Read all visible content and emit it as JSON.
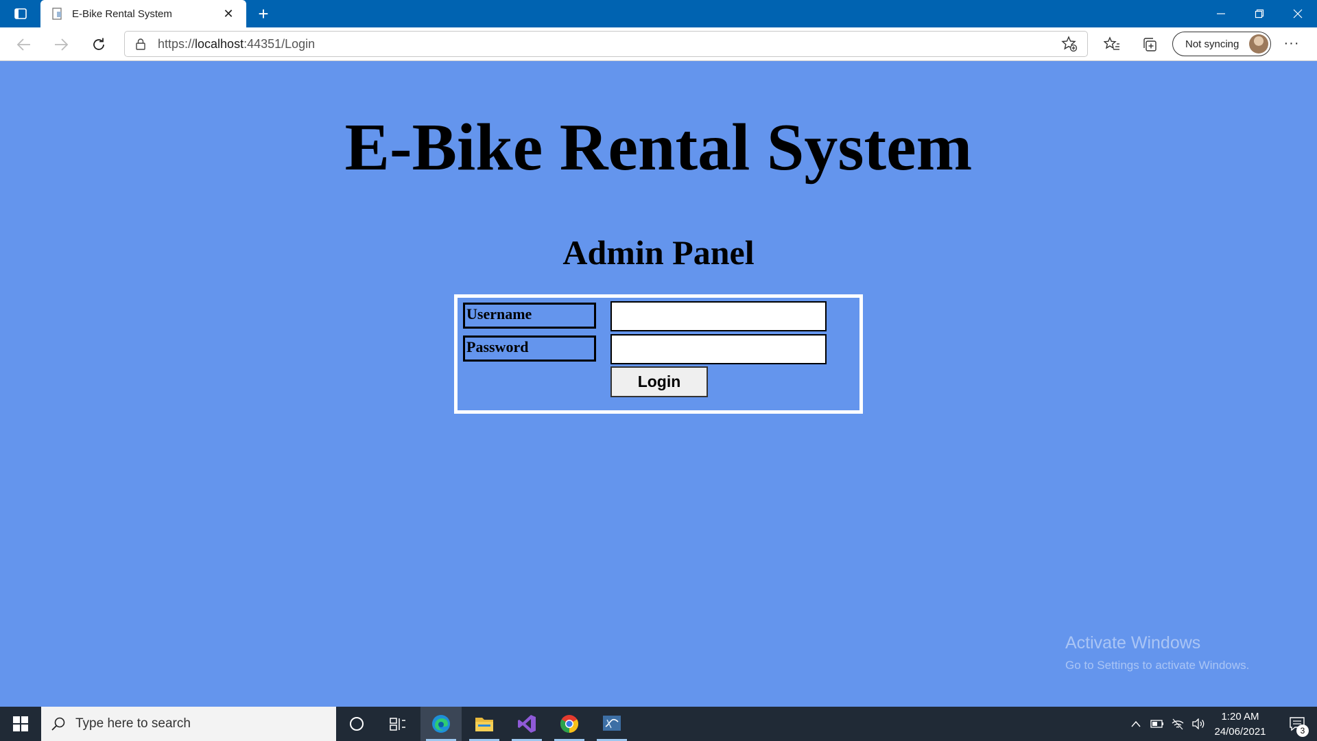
{
  "browser": {
    "tab_title": "E-Bike Rental System",
    "url_prefix": "https://",
    "url_host": "localhost",
    "url_rest": ":44351/Login",
    "sync_label": "Not syncing",
    "more_label": "···"
  },
  "page": {
    "title": "E-Bike Rental System",
    "subtitle": "Admin Panel",
    "username_label": "Username",
    "password_label": "Password",
    "username_value": "",
    "password_value": "",
    "login_label": "Login",
    "background_color": "#6495ed"
  },
  "watermark": {
    "line1": "Activate Windows",
    "line2": "Go to Settings to activate Windows."
  },
  "taskbar": {
    "search_placeholder": "Type here to search",
    "time": "1:20 AM",
    "date": "24/06/2021",
    "notification_count": "3",
    "apps": [
      "cortana-icon",
      "task-view-icon",
      "edge-icon",
      "file-explorer-icon",
      "visual-studio-icon",
      "chrome-icon",
      "sql-server-icon"
    ]
  }
}
